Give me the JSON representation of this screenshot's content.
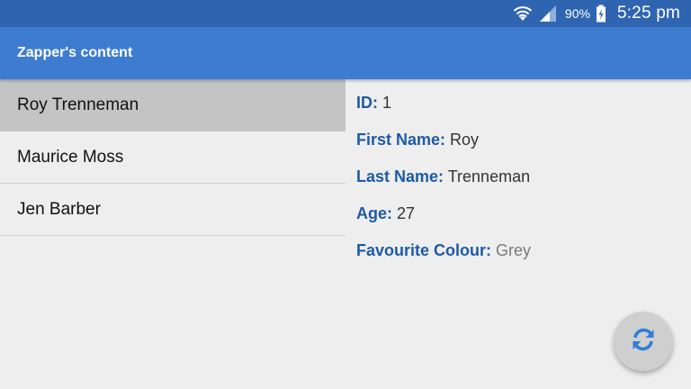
{
  "status_bar": {
    "battery_percent": "90%",
    "time": "5:25 pm",
    "icons": [
      "wifi-icon",
      "signal-icon",
      "battery-charging-icon"
    ]
  },
  "app_bar": {
    "title": "Zapper's content"
  },
  "list": {
    "items": [
      {
        "label": "Roy Trenneman",
        "selected": true
      },
      {
        "label": "Maurice Moss",
        "selected": false
      },
      {
        "label": "Jen Barber",
        "selected": false
      }
    ]
  },
  "detail": {
    "id": {
      "label": "ID:",
      "value": "1"
    },
    "first_name": {
      "label": "First Name:",
      "value": "Roy"
    },
    "last_name": {
      "label": "Last Name:",
      "value": "Trenneman"
    },
    "age": {
      "label": "Age:",
      "value": "27"
    },
    "favourite_colour": {
      "label": "Favourite Colour:",
      "value": "Grey"
    }
  },
  "fab": {
    "icon": "refresh-icon"
  },
  "colors": {
    "status_bar": "#2f65b0",
    "app_bar": "#3e7cd0",
    "label_blue": "#1f5aa6",
    "selected_row": "#c4c4c4",
    "fab_bg": "#cfcfcf",
    "fab_icon": "#2f7fd4"
  }
}
